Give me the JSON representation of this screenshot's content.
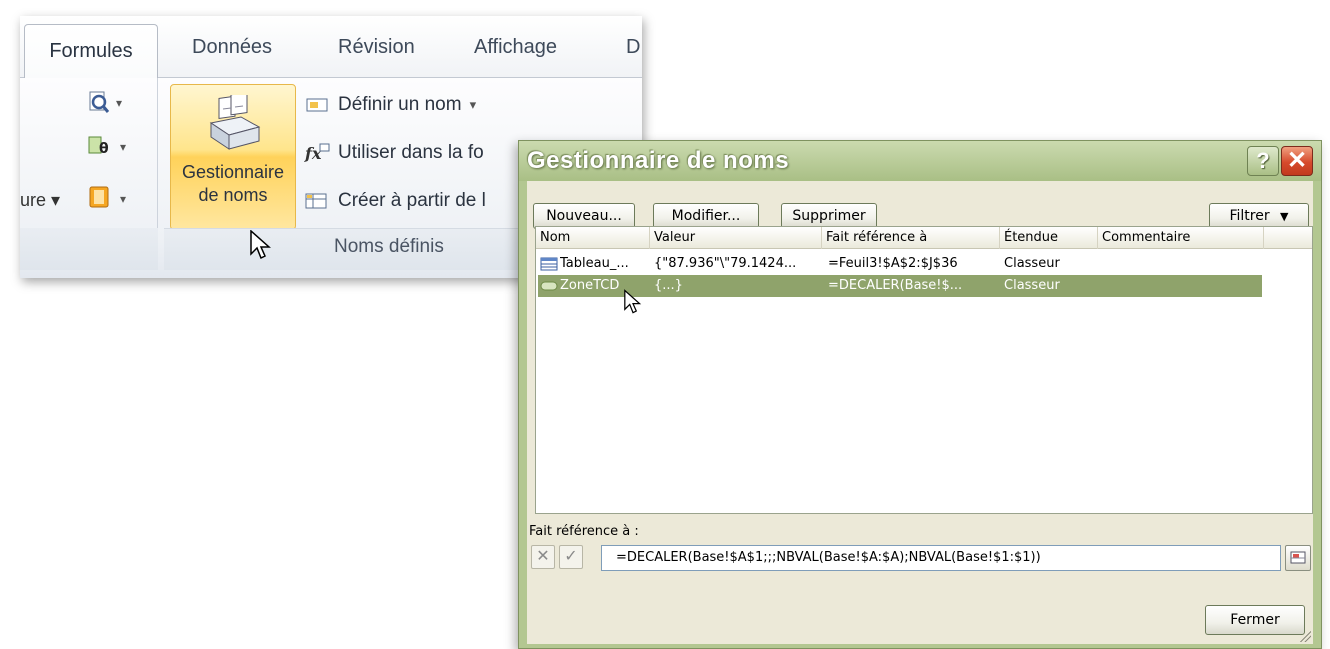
{
  "ribbon": {
    "tabs": [
      "Formules",
      "Données",
      "Révision",
      "Affichage",
      "D"
    ],
    "active_tab": "Formules",
    "left_group": {
      "partial_label": "ure"
    },
    "names_group": {
      "title": "Noms définis",
      "name_manager_button": {
        "line1": "Gestionnaire",
        "line2": "de noms"
      },
      "commands": [
        "Définir un nom",
        "Utiliser dans la fo",
        "Créer à partir de l"
      ]
    }
  },
  "dialog": {
    "title": "Gestionnaire de noms",
    "help_label": "?",
    "close_label": "✕",
    "buttons": {
      "new": "Nouveau...",
      "edit": "Modifier...",
      "delete": "Supprimer",
      "filter": "Filtrer"
    },
    "columns": [
      "Nom",
      "Valeur",
      "Fait référence à",
      "Étendue",
      "Commentaire"
    ],
    "rows": [
      {
        "name": "Tableau_...",
        "value": "{\"87.936\"\\\"79.1424...",
        "refers_to": "=Feuil3!$A$2:$J$36",
        "scope": "Classeur",
        "comment": "",
        "icon": "table-icon",
        "selected": false
      },
      {
        "name": "ZoneTCD",
        "value": "{...}",
        "refers_to": "=DECALER(Base!$...",
        "scope": "Classeur",
        "comment": "",
        "icon": "named-range-icon",
        "selected": true
      }
    ],
    "refers_to_label": "Fait référence à :",
    "refers_to_value": "=DECALER(Base!$A$1;;;NBVAL(Base!$A:$A);NBVAL(Base!$1:$1))",
    "close_button": "Fermer"
  },
  "colors": {
    "dialog_frame": "#b3c791",
    "selection": "#8fa36b",
    "ribbon_highlight": "#ffd25a",
    "close_button": "#d64a2c"
  }
}
